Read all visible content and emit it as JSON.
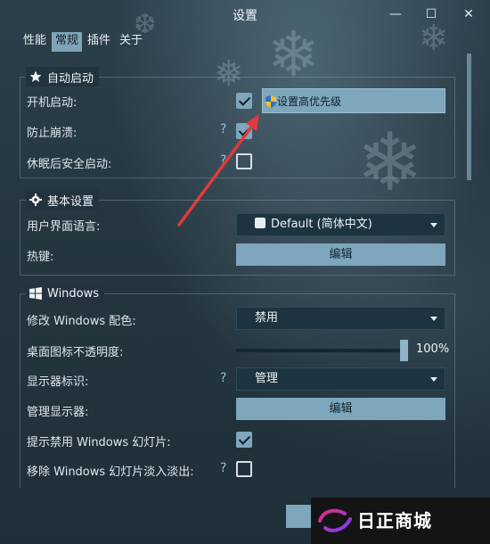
{
  "window": {
    "title": "设置",
    "controls": {
      "minimize": "—",
      "maximize": "☐",
      "close": "✕"
    }
  },
  "tabs": [
    {
      "label": "性能",
      "active": false
    },
    {
      "label": "常规",
      "active": true
    },
    {
      "label": "插件",
      "active": false
    },
    {
      "label": "关于",
      "active": false
    }
  ],
  "groups": {
    "autostart": {
      "title": "自动启动",
      "icon": "star-icon",
      "rows": [
        {
          "label": "开机启动:",
          "checked": true,
          "help": ""
        },
        {
          "label": "防止崩溃:",
          "checked": true,
          "help": "?"
        },
        {
          "label": "休眠后安全启动:",
          "checked": false,
          "help": "?"
        }
      ],
      "tooltip": "设置高优先级"
    },
    "basic": {
      "title": "基本设置",
      "icon": "gear-icon",
      "language_label": "用户界面语言:",
      "language_value": "Default (简体中文)",
      "hotkey_label": "热键:",
      "hotkey_button": "编辑"
    },
    "windows": {
      "title": "Windows",
      "icon": "windows-logo-icon",
      "color_label": "修改 Windows 配色:",
      "color_value": "禁用",
      "opacity_label": "桌面图标不透明度:",
      "opacity_value": "100%",
      "opacity_level": 1.0,
      "monitor_label": "显示器标识:",
      "monitor_help": "?",
      "monitor_value": "管理",
      "manage_label": "管理显示器:",
      "manage_button": "编辑",
      "slideshow_label": "提示禁用 Windows 幻灯片:",
      "slideshow_checked": true,
      "fade_label": "移除 Windows 幻灯片淡入淡出:",
      "fade_help": "?",
      "fade_checked": false
    }
  },
  "watermark": {
    "text": "日正商城"
  },
  "colors": {
    "accent": "#7ea6bd",
    "background": "#233540",
    "arrow": "#e03a3a",
    "help": "#8fc2e0"
  }
}
